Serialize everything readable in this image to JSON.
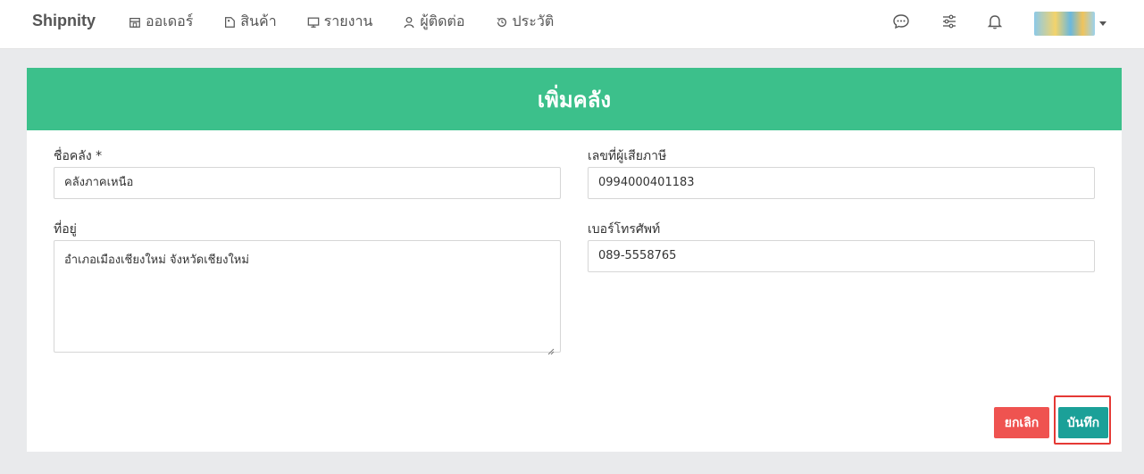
{
  "nav": {
    "brand": "Shipnity",
    "items": [
      {
        "label": "ออเดอร์",
        "icon": "store-icon"
      },
      {
        "label": "สินค้า",
        "icon": "tag-icon"
      },
      {
        "label": "รายงาน",
        "icon": "monitor-icon"
      },
      {
        "label": "ผู้ติดต่อ",
        "icon": "user-icon"
      },
      {
        "label": "ประวัติ",
        "icon": "history-icon"
      }
    ],
    "right_icons": [
      "chat-icon",
      "sliders-icon",
      "bell-icon"
    ]
  },
  "form": {
    "title": "เพิ่มคลัง",
    "warehouse_name": {
      "label": "ชื่อคลัง *",
      "value": "คลังภาคเหนือ"
    },
    "tax_id": {
      "label": "เลขที่ผู้เสียภาษี",
      "value": "0994000401183"
    },
    "address": {
      "label": "ที่อยู่",
      "value": "อำเภอเมืองเชียงใหม่ จังหวัดเชียงใหม่"
    },
    "phone": {
      "label": "เบอร์โทรศัพท์",
      "value": "089-5558765"
    },
    "cancel_label": "ยกเลิก",
    "save_label": "บันทึก"
  },
  "colors": {
    "header_green": "#3cc08b",
    "cancel_red": "#ef5350",
    "save_teal": "#1ba098",
    "highlight_red": "#e53935"
  }
}
